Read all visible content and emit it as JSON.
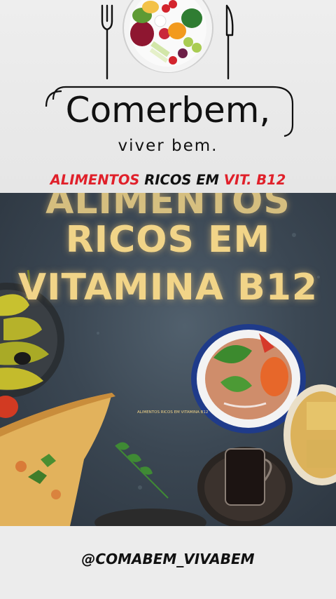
{
  "brand": {
    "title": "Comerbem,",
    "subtitle": "viver bem."
  },
  "headline": {
    "word1": "ALIMENTOS",
    "word2": " RICOS EM ",
    "word3": "VIT. B12"
  },
  "photo": {
    "line1": "ALIMENTOS",
    "line2": "RICOS EM",
    "line3": "VITAMINA B12",
    "caption": "ALIMENTOS RICOS EM VITAMINA B12"
  },
  "footer": {
    "handle": "@COMABEM_VIVABEM"
  },
  "colors": {
    "accent_red": "#e0202a",
    "gold_text": "#f1d488",
    "background": "#ececec"
  }
}
